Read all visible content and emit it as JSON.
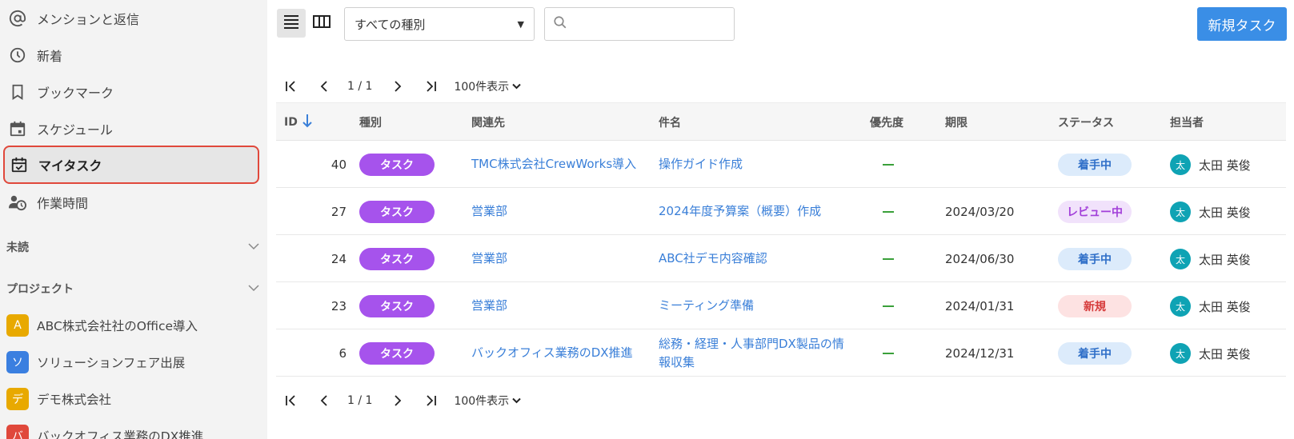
{
  "sidebar": {
    "nav": [
      {
        "label": "メンションと返信",
        "icon": "at-icon"
      },
      {
        "label": "新着",
        "icon": "clock-icon"
      },
      {
        "label": "ブックマーク",
        "icon": "bookmark-icon"
      },
      {
        "label": "スケジュール",
        "icon": "calendar-icon"
      },
      {
        "label": "マイタスク",
        "icon": "calendar-check-icon"
      },
      {
        "label": "作業時間",
        "icon": "person-clock-icon"
      }
    ],
    "unread_label": "未読",
    "projects_label": "プロジェクト",
    "projects": [
      {
        "letter": "A",
        "label": "ABC株式会社社のOffice導入",
        "color": "#e8a900"
      },
      {
        "letter": "ソ",
        "label": "ソリューションフェア出展",
        "color": "#3a7fe0"
      },
      {
        "letter": "デ",
        "label": "デモ株式会社",
        "color": "#e8a900"
      },
      {
        "letter": "バ",
        "label": "バックオフィス業務のDX推進",
        "color": "#e0483b"
      }
    ]
  },
  "toolbar": {
    "type_select_value": "すべての種別",
    "search_placeholder": "",
    "new_task_label": "新規タスク"
  },
  "pager": {
    "page_info": "1 / 1",
    "page_size": "100件表示"
  },
  "table": {
    "headers": {
      "id": "ID",
      "type": "種別",
      "related": "関連先",
      "subject": "件名",
      "priority": "優先度",
      "due": "期限",
      "status": "ステータス",
      "assignee": "担当者"
    },
    "rows": [
      {
        "id": "40",
        "type": "タスク",
        "related": "TMC株式会社CrewWorks導入",
        "subject": "操作ガイド作成",
        "due": "",
        "status": "着手中",
        "assignee_initial": "太",
        "assignee": "太田 英俊"
      },
      {
        "id": "27",
        "type": "タスク",
        "related": "営業部",
        "subject": "2024年度予算案（概要）作成",
        "due": "2024/03/20",
        "status": "レビュー中",
        "assignee_initial": "太",
        "assignee": "太田 英俊"
      },
      {
        "id": "24",
        "type": "タスク",
        "related": "営業部",
        "subject": "ABC社デモ内容確認",
        "due": "2024/06/30",
        "status": "着手中",
        "assignee_initial": "太",
        "assignee": "太田 英俊"
      },
      {
        "id": "23",
        "type": "タスク",
        "related": "営業部",
        "subject": "ミーティング準備",
        "due": "2024/01/31",
        "status": "新規",
        "assignee_initial": "太",
        "assignee": "太田 英俊"
      },
      {
        "id": "6",
        "type": "タスク",
        "related": "バックオフィス業務のDX推進",
        "subject": "総務・経理・人事部門DX製品の情報収集",
        "due": "2024/12/31",
        "status": "着手中",
        "assignee_initial": "太",
        "assignee": "太田 英俊"
      }
    ]
  },
  "status_colors": {
    "着手中": {
      "bg": "#dcebfb",
      "fg": "#2f6fc8"
    },
    "レビュー中": {
      "bg": "#f1e2fb",
      "fg": "#a23fd9"
    },
    "新規": {
      "bg": "#fde2e2",
      "fg": "#d63a3a"
    }
  }
}
